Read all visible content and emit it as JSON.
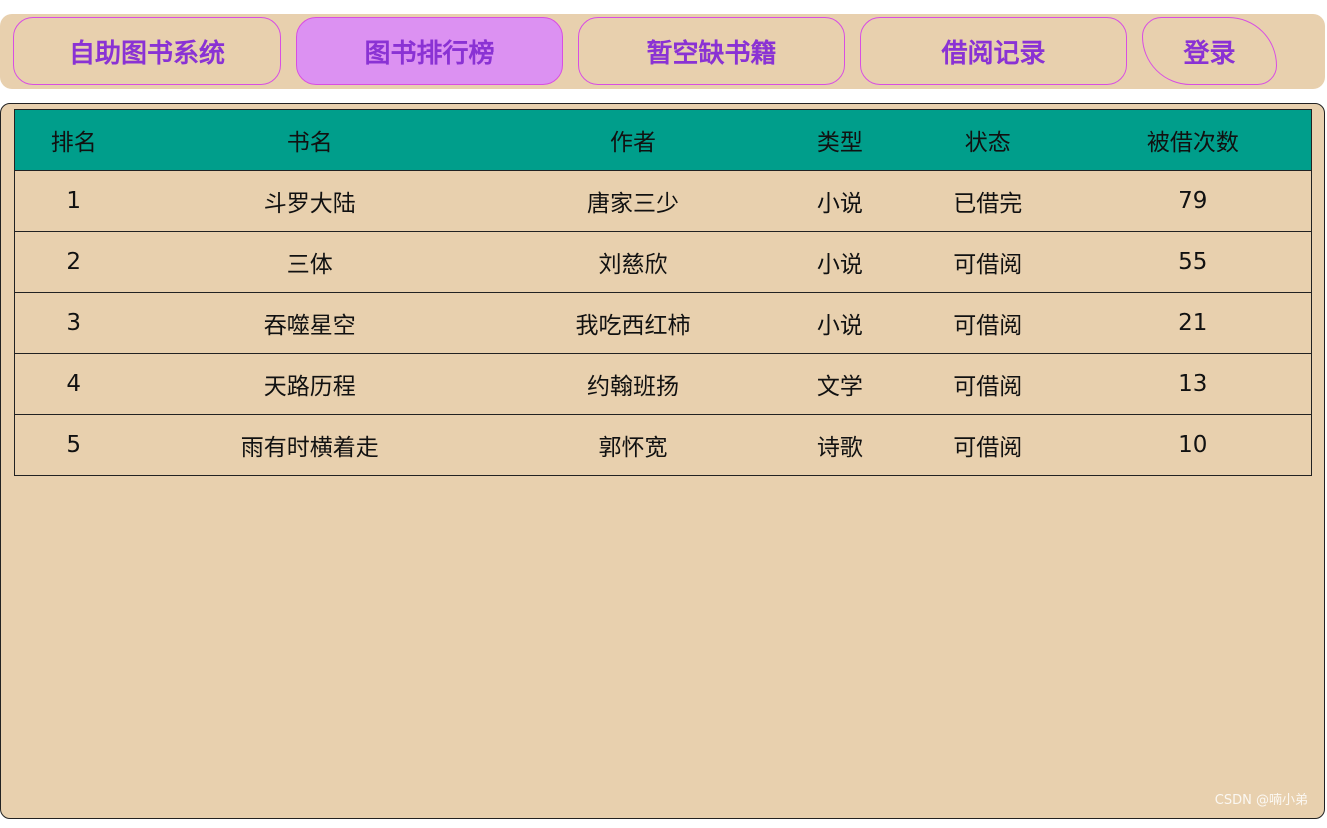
{
  "nav": {
    "items": [
      {
        "label": "自助图书系统",
        "active": false
      },
      {
        "label": "图书排行榜",
        "active": true
      },
      {
        "label": "暂空缺书籍",
        "active": false
      },
      {
        "label": "借阅记录",
        "active": false
      },
      {
        "label": "登录",
        "active": false
      }
    ]
  },
  "table": {
    "headers": [
      "排名",
      "书名",
      "作者",
      "类型",
      "状态",
      "被借次数"
    ],
    "rows": [
      [
        "1",
        "斗罗大陆",
        "唐家三少",
        "小说",
        "已借完",
        "79"
      ],
      [
        "2",
        "三体",
        "刘慈欣",
        "小说",
        "可借阅",
        "55"
      ],
      [
        "3",
        "吞噬星空",
        "我吃西红柿",
        "小说",
        "可借阅",
        "21"
      ],
      [
        "4",
        "天路历程",
        "约翰班扬",
        "文学",
        "可借阅",
        "13"
      ],
      [
        "5",
        "雨有时横着走",
        "郭怀宽",
        "诗歌",
        "可借阅",
        "10"
      ]
    ]
  },
  "watermark": "CSDN @喃小弟",
  "colors": {
    "background": "#e8d0ae",
    "accent_text": "#8a32d4",
    "active_tab": "#dc91f2",
    "button_border": "#d84ee3",
    "table_header": "#009e8b"
  }
}
